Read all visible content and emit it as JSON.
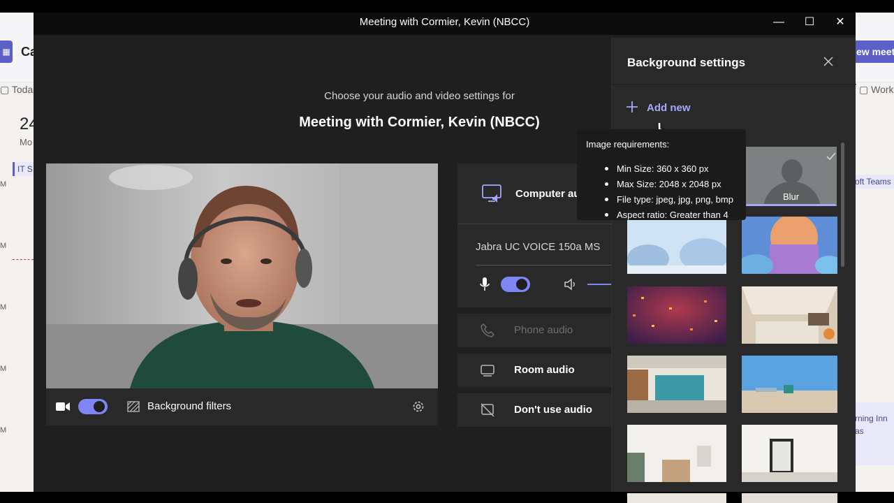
{
  "background_app": {
    "title": "Ca",
    "today_label": "Toda",
    "date_number": "24",
    "date_day": "Mo",
    "event_left": "IT S",
    "hour_marks": [
      "M",
      "M",
      "M",
      "M",
      "M"
    ],
    "new_meeting_label": "ew meeti",
    "work_label": "Work",
    "event_right_teams": "oft Teams",
    "event_right_innovation": "rning Inn",
    "event_right_innovation_2": "as"
  },
  "window": {
    "title": "Meeting with Cormier, Kevin (NBCC)",
    "minimize": "—",
    "maximize": "☐",
    "close": "✕"
  },
  "prejoin": {
    "prompt": "Choose your audio and video settings for",
    "meeting_title": "Meeting with Cormier, Kevin (NBCC)"
  },
  "video_bar": {
    "camera_on": true,
    "background_filters_label": "Background filters"
  },
  "audio": {
    "computer_audio_label": "Computer au",
    "device_name": "Jabra UC VOICE 150a MS",
    "mic_on": true,
    "phone_audio_label": "Phone audio",
    "room_audio_label": "Room audio",
    "no_audio_label": "Don't use audio"
  },
  "background_panel": {
    "title": "Background settings",
    "add_new_label": "Add new",
    "blur_label": "Blur"
  },
  "tooltip": {
    "title": "Image requirements:",
    "items": [
      "Min Size: 360 x 360 px",
      "Max Size: 2048 x 2048 px",
      "File type: jpeg, jpg, png, bmp",
      "Aspect ratio: Greater than 4"
    ]
  },
  "colors": {
    "accent": "#7f85f5",
    "accent_text": "#a6a9f9",
    "dialog_bg": "#1f1f1f",
    "card_bg": "#292929"
  }
}
